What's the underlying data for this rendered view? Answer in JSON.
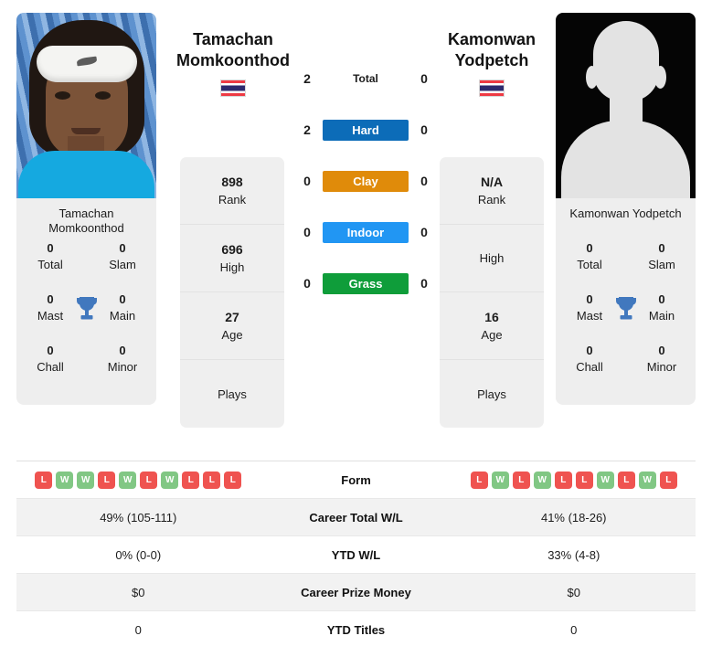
{
  "players": {
    "left": {
      "name": "Tamachan Momkoonthod",
      "name_line1": "Tamachan",
      "name_line2": "Momkoonthod",
      "photo_caption": "Tamachan Momkoonthod",
      "country": "Thailand",
      "flag_icon": "thailand-flag-icon",
      "titles": {
        "total_value": "0",
        "total_label": "Total",
        "slam_value": "0",
        "slam_label": "Slam",
        "mast_value": "0",
        "mast_label": "Mast",
        "main_value": "0",
        "main_label": "Main",
        "chall_value": "0",
        "chall_label": "Chall",
        "minor_value": "0",
        "minor_label": "Minor"
      },
      "stats": [
        {
          "value": "898",
          "label": "Rank"
        },
        {
          "value": "696",
          "label": "High"
        },
        {
          "value": "27",
          "label": "Age"
        },
        {
          "value": "",
          "label": "Plays"
        }
      ],
      "form": [
        "L",
        "W",
        "W",
        "L",
        "W",
        "L",
        "W",
        "L",
        "L",
        "L"
      ],
      "career_total_wl": "49% (105-111)",
      "ytd_wl": "0% (0-0)",
      "career_prize_money": "$0",
      "ytd_titles": "0"
    },
    "right": {
      "name": "Kamonwan Yodpetch",
      "name_line1": "Kamonwan",
      "name_line2": "Yodpetch",
      "photo_caption": "Kamonwan Yodpetch",
      "country": "Thailand",
      "flag_icon": "thailand-flag-icon",
      "titles": {
        "total_value": "0",
        "total_label": "Total",
        "slam_value": "0",
        "slam_label": "Slam",
        "mast_value": "0",
        "mast_label": "Mast",
        "main_value": "0",
        "main_label": "Main",
        "chall_value": "0",
        "chall_label": "Chall",
        "minor_value": "0",
        "minor_label": "Minor"
      },
      "stats": [
        {
          "value": "N/A",
          "label": "Rank"
        },
        {
          "value": "",
          "label": "High"
        },
        {
          "value": "16",
          "label": "Age"
        },
        {
          "value": "",
          "label": "Plays"
        }
      ],
      "form": [
        "L",
        "W",
        "L",
        "W",
        "L",
        "L",
        "W",
        "L",
        "W",
        "L"
      ],
      "career_total_wl": "41% (18-26)",
      "ytd_wl": "33% (4-8)",
      "career_prize_money": "$0",
      "ytd_titles": "0"
    }
  },
  "surfaces": [
    {
      "label": "Total",
      "left": "2",
      "right": "0",
      "color": "transparent",
      "plain": true
    },
    {
      "label": "Hard",
      "left": "2",
      "right": "0",
      "color": "#0c6cb8",
      "plain": false
    },
    {
      "label": "Clay",
      "left": "0",
      "right": "0",
      "color": "#e08b0a",
      "plain": false
    },
    {
      "label": "Indoor",
      "left": "0",
      "right": "0",
      "color": "#2196f3",
      "plain": false
    },
    {
      "label": "Grass",
      "left": "0",
      "right": "0",
      "color": "#0f9d3a",
      "plain": false
    }
  ],
  "comparison_rows": [
    {
      "label": "Form",
      "type": "form"
    },
    {
      "label": "Career Total W/L",
      "type": "text",
      "left": "49% (105-111)",
      "right": "41% (18-26)"
    },
    {
      "label": "YTD W/L",
      "type": "text",
      "left": "0% (0-0)",
      "right": "33% (4-8)"
    },
    {
      "label": "Career Prize Money",
      "type": "text",
      "left": "$0",
      "right": "$0"
    },
    {
      "label": "YTD Titles",
      "type": "text",
      "left": "0",
      "right": "0"
    }
  ],
  "colors": {
    "hard": "#0c6cb8",
    "clay": "#e08b0a",
    "indoor": "#2196f3",
    "grass": "#0f9d3a",
    "win_badge": "#81c784",
    "loss_badge": "#ef5350",
    "trophy": "#4178be"
  },
  "icons": {
    "trophy": "trophy-icon",
    "flag": "thailand-flag-icon"
  }
}
